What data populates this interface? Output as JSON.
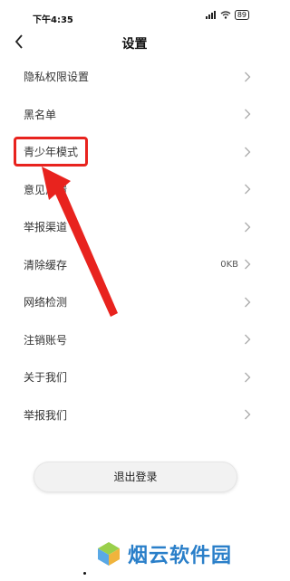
{
  "status": {
    "time": "下午4:35",
    "battery": "89"
  },
  "header": {
    "title": "设置"
  },
  "settings": [
    {
      "label": "隐私权限设置",
      "value": ""
    },
    {
      "label": "黑名单",
      "value": ""
    },
    {
      "label": "青少年模式",
      "value": ""
    },
    {
      "label": "意见反馈",
      "value": ""
    },
    {
      "label": "举报渠道",
      "value": ""
    },
    {
      "label": "清除缓存",
      "value": "0KB"
    },
    {
      "label": "网络检测",
      "value": ""
    },
    {
      "label": "注销账号",
      "value": ""
    },
    {
      "label": "关于我们",
      "value": ""
    },
    {
      "label": "举报我们",
      "value": ""
    }
  ],
  "logout": {
    "label": "退出登录"
  },
  "watermark": {
    "text": "烟云软件园"
  },
  "colors": {
    "annotation_red": "#e8231e",
    "watermark_blue": "#2a7fc9"
  }
}
